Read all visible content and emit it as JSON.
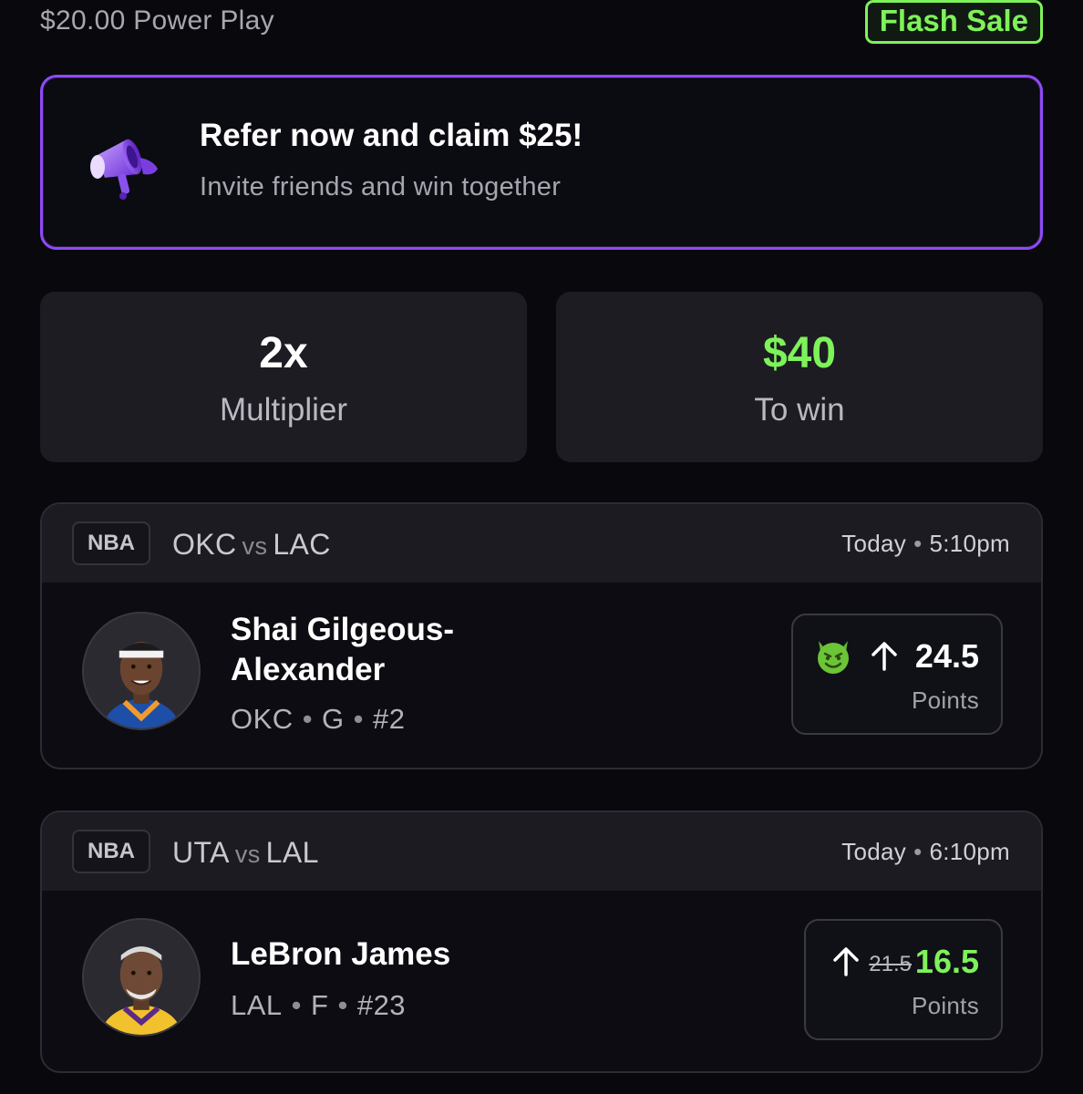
{
  "header": {
    "play_title": "$20.00 Power Play",
    "flash_badge": "Flash Sale"
  },
  "referral": {
    "title": "Refer now and claim $25!",
    "subtitle": "Invite friends and win together",
    "icon": "megaphone-icon"
  },
  "stats": {
    "multiplier_value": "2x",
    "multiplier_label": "Multiplier",
    "payout_value": "$40",
    "payout_label": "To win"
  },
  "picks": [
    {
      "league": "NBA",
      "home": "OKC",
      "vs": "vs",
      "away": "LAC",
      "day": "Today",
      "time": "5:10pm",
      "player_name": "Shai Gilgeous-Alexander",
      "team": "OKC",
      "position": "G",
      "number": "#2",
      "direction": "up",
      "line": "24.5",
      "unit": "Points",
      "badge_icon": "devil-emoji-icon"
    },
    {
      "league": "NBA",
      "home": "UTA",
      "vs": "vs",
      "away": "LAL",
      "day": "Today",
      "time": "6:10pm",
      "player_name": "LeBron James",
      "team": "LAL",
      "position": "F",
      "number": "#23",
      "direction": "up",
      "original_line": "21.5",
      "line": "16.5",
      "unit": "Points"
    }
  ],
  "separator_dot": "•",
  "colors": {
    "background": "#08080d",
    "card": "#1d1c23",
    "accent_green": "#7ef25a",
    "accent_purple": "#8f4af6"
  }
}
